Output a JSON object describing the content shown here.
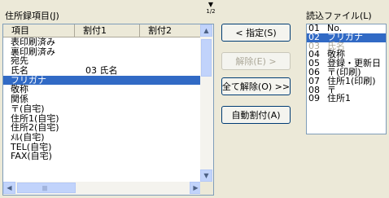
{
  "left_panel": {
    "label": "住所録項目(J)",
    "columns": [
      "項目",
      "割付1",
      "割付2"
    ],
    "rows": [
      {
        "item": "表印刷済み",
        "assign1": ""
      },
      {
        "item": "裏印刷済み",
        "assign1": ""
      },
      {
        "item": "宛先",
        "assign1": ""
      },
      {
        "item": "氏名",
        "assign1": "03 氏名"
      },
      {
        "item": "フリガナ",
        "assign1": "",
        "selected": true
      },
      {
        "item": "敬称",
        "assign1": ""
      },
      {
        "item": "関係",
        "assign1": ""
      },
      {
        "item": "〒(自宅)",
        "assign1": ""
      },
      {
        "item": "住所1(自宅)",
        "assign1": ""
      },
      {
        "item": "住所2(自宅)",
        "assign1": ""
      },
      {
        "item": "ﾒﾙ(自宅)",
        "assign1": ""
      },
      {
        "item": "TEL(自宅)",
        "assign1": ""
      },
      {
        "item": "FAX(自宅)",
        "assign1": ""
      }
    ]
  },
  "buttons": {
    "assign": "< 指定(S)",
    "release": "解除(E) >",
    "release_all": "全て解除(O) >>",
    "auto_assign": "自動割付(A)"
  },
  "right_panel": {
    "label": "読込ファイル(L)",
    "rows": [
      {
        "num": "01",
        "text": "No."
      },
      {
        "num": "02",
        "text": "フリガナ",
        "selected": true
      },
      {
        "num": "03",
        "text": "氏名",
        "dim": true
      },
      {
        "num": "04",
        "text": "敬称"
      },
      {
        "num": "05",
        "text": "登録・更新日"
      },
      {
        "num": "06",
        "text": "〒(印刷)"
      },
      {
        "num": "07",
        "text": "住所1(印刷)"
      },
      {
        "num": "08",
        "text": "〒"
      },
      {
        "num": "09",
        "text": "住所1"
      }
    ]
  },
  "sort_icon": {
    "text": "1/2"
  },
  "colors": {
    "selection": "#316ac5",
    "dialog_bg": "#ece9d8",
    "border": "#7f9db9"
  }
}
